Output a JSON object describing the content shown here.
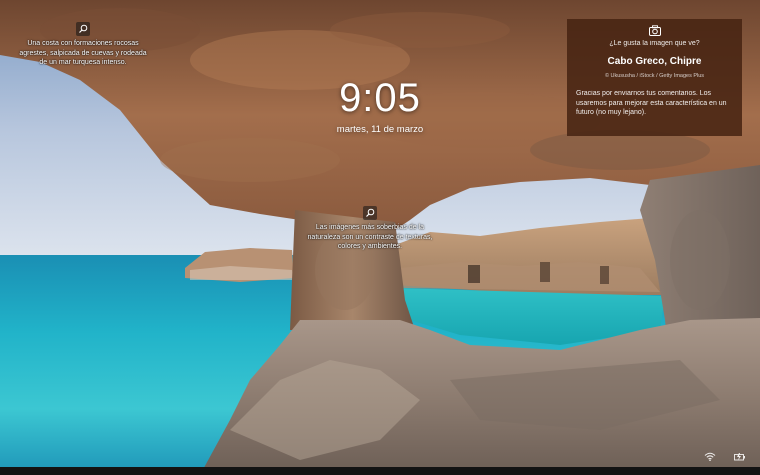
{
  "lockscreen": {
    "time": "9:05",
    "date": "martes, 11 de marzo"
  },
  "hotspots": [
    {
      "icon": "magnifier-icon",
      "text": "Una costa con formaciones rocosas agrestes, salpicada de cuevas y rodeada de un mar turquesa intenso."
    },
    {
      "icon": "magnifier-icon",
      "text": "Las imágenes más soberbias de la naturaleza son un contraste de texturas, colores y ambientes."
    }
  ],
  "info_card": {
    "icon": "camera-icon",
    "question": "¿Le gusta la imagen que ve?",
    "title": "Cabo Greco, Chipre",
    "credit": "© Ukususha / iStock / Getty Images Plus",
    "thanks": "Gracias por enviarnos tus comentarios. Los usaremos para mejorar esta característica en un futuro (no muy lejano)."
  },
  "tray": {
    "network_icon": "wifi-icon",
    "battery_icon": "battery-charging-icon"
  },
  "colors": {
    "card_bg": "#46231280",
    "sea": "#1eb7c8",
    "sky": "#c9d6e6",
    "rock": "#9a6a4a"
  }
}
